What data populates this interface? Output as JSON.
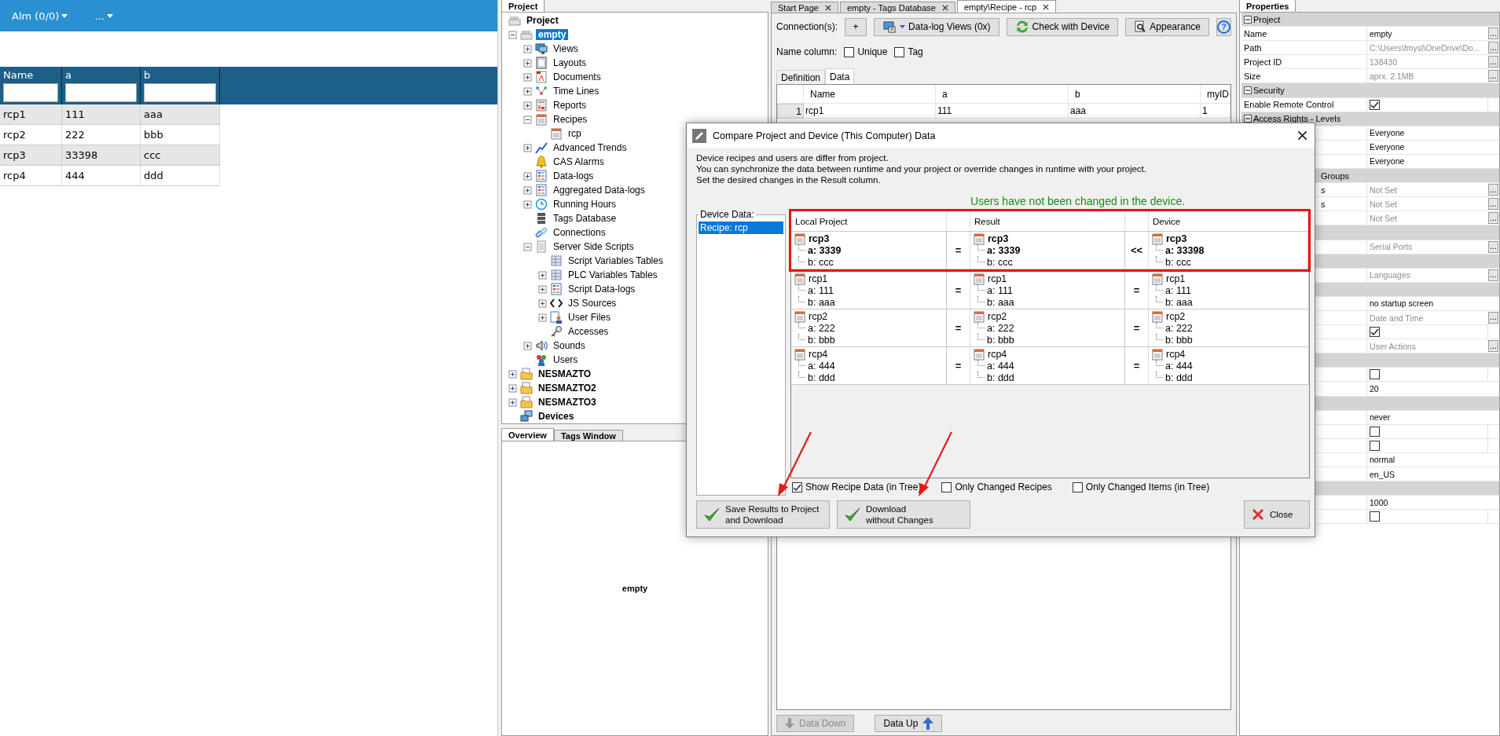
{
  "web_panel": {
    "menu": [
      {
        "label": "Alm (0/0)"
      },
      {
        "label": "..."
      }
    ],
    "table": {
      "columns": [
        "Name",
        "a",
        "b"
      ],
      "rows": [
        [
          "rcp1",
          "111",
          "aaa"
        ],
        [
          "rcp2",
          "222",
          "bbb"
        ],
        [
          "rcp3",
          "33398",
          "ccc"
        ],
        [
          "rcp4",
          "444",
          "ddd"
        ]
      ]
    }
  },
  "project_panel": {
    "tab": "Project",
    "tree_title": "Project",
    "tree": [
      {
        "label": "empty",
        "selected": true,
        "expanded": true,
        "children": [
          {
            "label": "Views",
            "selected": false,
            "expanded": false
          },
          {
            "label": "Layouts",
            "selected": false,
            "expanded": false
          },
          {
            "label": "Documents",
            "selected": false,
            "expanded": false
          },
          {
            "label": "Time Lines",
            "selected": false,
            "expanded": false
          },
          {
            "label": "Reports",
            "selected": false,
            "expanded": false
          },
          {
            "label": "Recipes",
            "selected": false,
            "expanded": true,
            "children": [
              {
                "label": "rcp",
                "selected": false
              }
            ]
          },
          {
            "label": "Advanced Trends",
            "selected": false,
            "expanded": false
          },
          {
            "label": "CAS Alarms",
            "selected": false
          },
          {
            "label": "Data-logs",
            "selected": false,
            "expanded": false
          },
          {
            "label": "Aggregated Data-logs",
            "selected": false,
            "expanded": false
          },
          {
            "label": "Running Hours",
            "selected": false,
            "expanded": false
          },
          {
            "label": "Tags Database",
            "selected": false
          },
          {
            "label": "Connections",
            "selected": false
          },
          {
            "label": "Server Side Scripts",
            "selected": false,
            "expanded": true,
            "children": [
              {
                "label": "Script Variables Tables",
                "selected": false
              },
              {
                "label": "PLC Variables Tables",
                "selected": false,
                "expanded": false
              },
              {
                "label": "Script Data-logs",
                "selected": false,
                "expanded": false
              },
              {
                "label": "JS Sources",
                "selected": false,
                "expanded": false
              },
              {
                "label": "User Files",
                "selected": false,
                "expanded": false
              },
              {
                "label": "Accesses",
                "selected": false
              }
            ]
          },
          {
            "label": "Sounds",
            "selected": false,
            "expanded": false
          },
          {
            "label": "Users",
            "selected": false
          }
        ]
      },
      {
        "label": "NESMAZTO",
        "selected": false,
        "expanded": false
      },
      {
        "label": "NESMAZTO2",
        "selected": false,
        "expanded": false
      },
      {
        "label": "NESMAZTO3",
        "selected": false,
        "expanded": false
      },
      {
        "label": "Devices",
        "selected": false
      }
    ]
  },
  "overview_panel": {
    "tabs": [
      {
        "label": "Overview",
        "selected": true
      },
      {
        "label": "Tags Window",
        "selected": false
      }
    ],
    "content": "empty"
  },
  "editor": {
    "tabs": [
      {
        "label": "Start Page",
        "selected": false
      },
      {
        "label": "empty - Tags Database",
        "selected": false
      },
      {
        "label": "empty\\Recipe - rcp",
        "selected": true
      }
    ],
    "connection_label": "Connection(s):",
    "toolbar": [
      {
        "label": "+"
      },
      {
        "label": "Data-log Views (0x)"
      },
      {
        "label": "Check with Device"
      },
      {
        "label": "Appearance"
      },
      {
        "label": "?"
      }
    ],
    "name_column_label": "Name column:",
    "name_options": [
      {
        "label": "Unique",
        "checked": false
      },
      {
        "label": "Tag",
        "checked": false
      }
    ],
    "subtabs": [
      {
        "label": "Definition",
        "selected": false
      },
      {
        "label": "Data",
        "selected": true
      }
    ],
    "table": {
      "columns": [
        "Name",
        "a",
        "b",
        "myID"
      ],
      "rows": [
        {
          "number": "1",
          "cells": [
            "rcp1",
            "111",
            "aaa",
            "1"
          ]
        }
      ]
    },
    "bottom_buttons": [
      {
        "label": "Data Down",
        "disabled": true
      },
      {
        "label": "Data Up",
        "disabled": false
      }
    ]
  },
  "properties_panel": {
    "tab": "Properties",
    "rows": [
      {
        "kind": "group",
        "label": "Project",
        "expanded": true
      },
      {
        "kind": "text",
        "label": "Name",
        "value": "empty",
        "muted": false,
        "button": "..."
      },
      {
        "kind": "text",
        "label": "Path",
        "value": "C:\\Users\\fmysl\\OneDrive\\Do...",
        "muted": true,
        "button": "..."
      },
      {
        "kind": "text",
        "label": "Project ID",
        "value": "138430",
        "muted": true,
        "button": "..."
      },
      {
        "kind": "text",
        "label": "Size",
        "value": "aprx. 2.1MB",
        "muted": true,
        "button": "..."
      },
      {
        "kind": "group",
        "label": "Security",
        "expanded": true
      },
      {
        "kind": "check",
        "label": "Enable Remote Control",
        "checked": true
      },
      {
        "kind": "group",
        "label": "Access Rights - Levels",
        "expanded": true
      },
      {
        "kind": "text",
        "value": "Everyone",
        "muted": false
      },
      {
        "kind": "text",
        "value": "Everyone",
        "muted": false
      },
      {
        "kind": "text",
        "value": "Everyone",
        "muted": false
      },
      {
        "kind": "group",
        "label": "Groups",
        "label_cut": true
      },
      {
        "kind": "text",
        "label": "s",
        "label_cut": true,
        "value": "Not Set",
        "muted": true,
        "button": "..."
      },
      {
        "kind": "text",
        "label": "s",
        "label_cut": true,
        "value": "Not Set",
        "muted": true,
        "button": "..."
      },
      {
        "kind": "text",
        "value": "Not Set",
        "muted": true,
        "button": "..."
      },
      {
        "kind": "group"
      },
      {
        "kind": "text",
        "value": "Serial Ports",
        "muted": true,
        "button": "..."
      },
      {
        "kind": "group"
      },
      {
        "kind": "text",
        "value": "Languages",
        "muted": true,
        "button": "..."
      },
      {
        "kind": "group"
      },
      {
        "kind": "text",
        "value": "no startup screen",
        "muted": false
      },
      {
        "kind": "text",
        "value": "Date and Time",
        "muted": true,
        "button": "..."
      },
      {
        "kind": "check",
        "checked": true
      },
      {
        "kind": "text",
        "value": "User Actions",
        "muted": true,
        "button": "..."
      },
      {
        "kind": "group"
      },
      {
        "kind": "check",
        "checked": false
      },
      {
        "kind": "text",
        "value": "20",
        "muted": false
      },
      {
        "kind": "group"
      },
      {
        "kind": "text",
        "value": "never",
        "muted": false
      },
      {
        "kind": "check",
        "checked": false
      },
      {
        "kind": "check",
        "checked": false
      },
      {
        "kind": "text",
        "value": "normal",
        "muted": false
      },
      {
        "kind": "text",
        "value": "en_US",
        "muted": false
      },
      {
        "kind": "group"
      },
      {
        "kind": "text",
        "value": "1000",
        "muted": false
      },
      {
        "kind": "check",
        "checked": false
      }
    ]
  },
  "dialog": {
    "title": "Compare Project and Device (This Computer) Data",
    "message_lines": [
      "Device recipes and users are differ from project.",
      "You can synchronize the data between runtime and your project or override changes in runtime with your project.",
      "Set the desired changes in the Result column."
    ],
    "status": "Users have not been changed in the device.",
    "device_data_label": "Device Data:",
    "device_data_items": [
      {
        "label": "Recipe: rcp",
        "selected": true
      }
    ],
    "compare": {
      "columns": [
        "Local Project",
        "Result",
        "Device"
      ],
      "rows": [
        {
          "highlighted": true,
          "changed": true,
          "local": {
            "name": "rcp3",
            "lines": [
              {
                "text": "a: 3339",
                "changed": true
              },
              {
                "text": "b: ccc",
                "changed": false
              }
            ]
          },
          "op_result": "=",
          "result": {
            "name": "rcp3",
            "lines": [
              {
                "text": "a: 3339",
                "changed": true
              },
              {
                "text": "b: ccc",
                "changed": false
              }
            ]
          },
          "op_device": "<<",
          "device": {
            "name": "rcp3",
            "lines": [
              {
                "text": "a: 33398",
                "changed": true
              },
              {
                "text": "b: ccc",
                "changed": false
              }
            ]
          }
        },
        {
          "highlighted": false,
          "changed": false,
          "local": {
            "name": "rcp1",
            "lines": [
              {
                "text": "a: 111",
                "changed": false
              },
              {
                "text": "b: aaa",
                "changed": false
              }
            ]
          },
          "op_result": "=",
          "result": {
            "name": "rcp1",
            "lines": [
              {
                "text": "a: 111",
                "changed": false
              },
              {
                "text": "b: aaa",
                "changed": false
              }
            ]
          },
          "op_device": "=",
          "device": {
            "name": "rcp1",
            "lines": [
              {
                "text": "a: 111",
                "changed": false
              },
              {
                "text": "b: aaa",
                "changed": false
              }
            ]
          }
        },
        {
          "highlighted": false,
          "changed": false,
          "local": {
            "name": "rcp2",
            "lines": [
              {
                "text": "a: 222",
                "changed": false
              },
              {
                "text": "b: bbb",
                "changed": false
              }
            ]
          },
          "op_result": "=",
          "result": {
            "name": "rcp2",
            "lines": [
              {
                "text": "a: 222",
                "changed": false
              },
              {
                "text": "b: bbb",
                "changed": false
              }
            ]
          },
          "op_device": "=",
          "device": {
            "name": "rcp2",
            "lines": [
              {
                "text": "a: 222",
                "changed": false
              },
              {
                "text": "b: bbb",
                "changed": false
              }
            ]
          }
        },
        {
          "highlighted": false,
          "changed": false,
          "local": {
            "name": "rcp4",
            "lines": [
              {
                "text": "a: 444",
                "changed": false
              },
              {
                "text": "b: ddd",
                "changed": false
              }
            ]
          },
          "op_result": "=",
          "result": {
            "name": "rcp4",
            "lines": [
              {
                "text": "a: 444",
                "changed": false
              },
              {
                "text": "b: ddd",
                "changed": false
              }
            ]
          },
          "op_device": "=",
          "device": {
            "name": "rcp4",
            "lines": [
              {
                "text": "a: 444",
                "changed": false
              },
              {
                "text": "b: ddd",
                "changed": false
              }
            ]
          }
        }
      ]
    },
    "options": [
      {
        "label": "Show Recipe Data (in Tree)",
        "checked": true
      },
      {
        "label": "Only Changed Recipes",
        "checked": false
      },
      {
        "label": "Only Changed Items (in Tree)",
        "checked": false
      }
    ],
    "buttons": [
      {
        "lines": [
          "Save Results to Project",
          "and Download"
        ],
        "arrow": true
      },
      {
        "lines": [
          "Download",
          "without Changes"
        ],
        "arrow": true
      }
    ],
    "close": "Close"
  }
}
